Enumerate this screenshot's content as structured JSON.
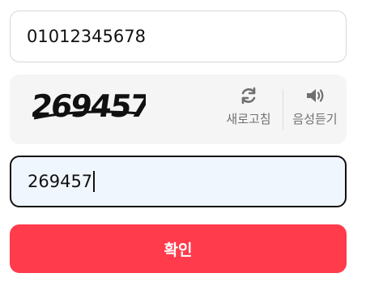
{
  "phone_input": {
    "value": "01012345678"
  },
  "captcha": {
    "image_text": "269457",
    "refresh_label": "새로고침",
    "audio_label": "음성듣기"
  },
  "answer_input": {
    "value": "269457"
  },
  "confirm_button": {
    "label": "확인",
    "color": "#ff3b4c"
  },
  "icons": {
    "refresh": "refresh-icon",
    "audio": "speaker-icon"
  }
}
